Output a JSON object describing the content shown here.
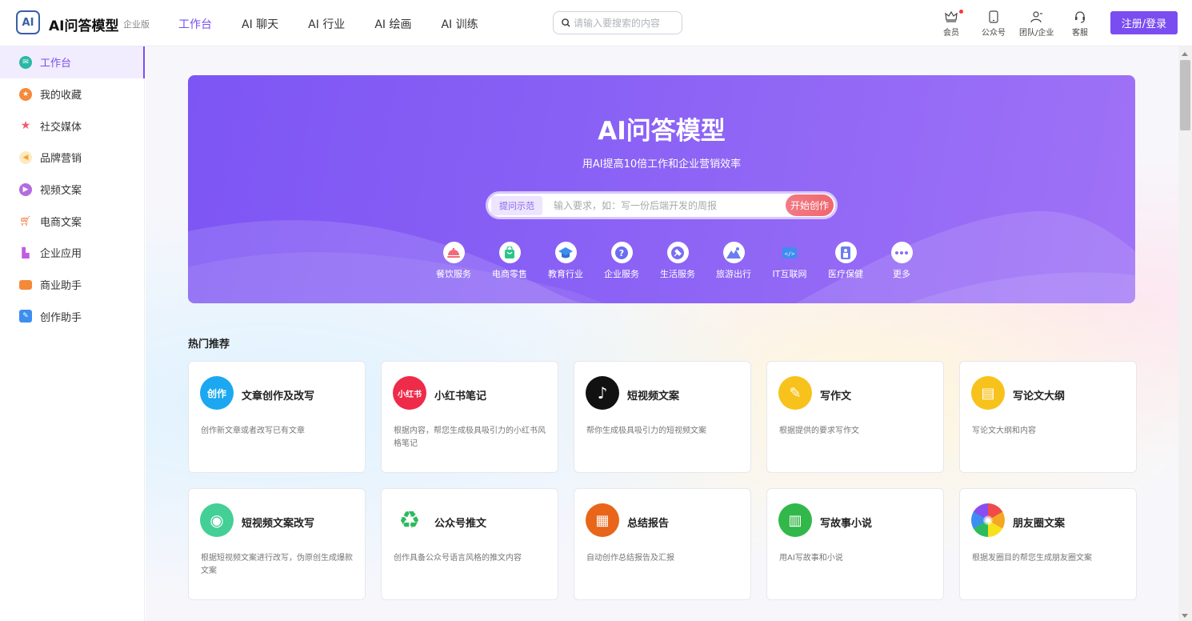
{
  "header": {
    "logo_text": "AI",
    "title": "AI问答模型",
    "edition": "企业版",
    "nav": [
      {
        "label": "工作台",
        "active": true
      },
      {
        "label": "AI 聊天"
      },
      {
        "label": "AI 行业"
      },
      {
        "label": "AI 绘画"
      },
      {
        "label": "AI 训练"
      }
    ],
    "search_placeholder": "请输入要搜索的内容",
    "tools": [
      {
        "label": "会员",
        "icon": "crown-icon"
      },
      {
        "label": "公众号",
        "icon": "phone-icon"
      },
      {
        "label": "团队/企业",
        "icon": "team-icon"
      },
      {
        "label": "客服",
        "icon": "headset-icon"
      }
    ],
    "login_label": "注册/登录"
  },
  "sidebar": {
    "items": [
      {
        "label": "工作台",
        "color": "#2bb9a6",
        "active": true
      },
      {
        "label": "我的收藏",
        "color": "#f58a3c"
      },
      {
        "label": "社交媒体",
        "color": "#ef5a6b"
      },
      {
        "label": "品牌营销",
        "color": "#f5a623"
      },
      {
        "label": "视频文案",
        "color": "#b46be0"
      },
      {
        "label": "电商文案",
        "color": "#f47a3a"
      },
      {
        "label": "企业应用",
        "color": "#c15be0"
      },
      {
        "label": "商业助手",
        "color": "#f5893a"
      },
      {
        "label": "创作助手",
        "color": "#3d8ef0"
      }
    ]
  },
  "banner": {
    "title": "AI问答模型",
    "subtitle": "用AI提高10倍工作和企业营销效率",
    "prompt_tag": "提问示范",
    "prompt_placeholder": "输入要求，如：写一份后端开发的周报",
    "prompt_button": "开始创作",
    "industries": [
      {
        "label": "餐饮服务",
        "icon": "dish-icon",
        "color": "#f06a7e"
      },
      {
        "label": "电商零售",
        "icon": "shopping-bag-icon",
        "color": "#2bc58a"
      },
      {
        "label": "教育行业",
        "icon": "graduation-cap-icon",
        "color": "#3d8ef0"
      },
      {
        "label": "企业服务",
        "icon": "question-icon",
        "color": "#6b6df0"
      },
      {
        "label": "生活服务",
        "icon": "hammer-icon",
        "color": "#7a6df0"
      },
      {
        "label": "旅游出行",
        "icon": "mountain-icon",
        "color": "#6a7ef0"
      },
      {
        "label": "IT互联网",
        "icon": "code-icon",
        "color": "#3d8ef0"
      },
      {
        "label": "医疗保健",
        "icon": "medical-icon",
        "color": "#6b7ef0"
      },
      {
        "label": "更多",
        "icon": "more-icon",
        "color": "#8a6df0"
      }
    ]
  },
  "hot": {
    "title": "热门推荐",
    "cards": [
      {
        "title": "文章创作及改写",
        "desc": "创作新文章或者改写已有文章",
        "icon": "write-icon",
        "icon_text": "创作",
        "color": "#1ba8f0"
      },
      {
        "title": "小红书笔记",
        "desc": "根据内容，帮您生成极具吸引力的小红书风格笔记",
        "icon": "xiaohongshu-icon",
        "icon_text": "小红书",
        "color": "#ef2b4a"
      },
      {
        "title": "短视频文案",
        "desc": "帮你生成极具吸引力的短视频文案",
        "icon": "tiktok-icon",
        "icon_text": "♪",
        "color": "#111111"
      },
      {
        "title": "写作文",
        "desc": "根据提供的要求写作文",
        "icon": "pencil-note-icon",
        "icon_text": "✎",
        "color": "#f7c21b"
      },
      {
        "title": "写论文大纲",
        "desc": "写论文大纲和内容",
        "icon": "document-icon",
        "icon_text": "▤",
        "color": "#f7c21b"
      },
      {
        "title": "短视频文案改写",
        "desc": "根据短视频文案进行改写，伪原创生成爆款文案",
        "icon": "camera-icon",
        "icon_text": "◉",
        "color": "#43cf96"
      },
      {
        "title": "公众号推文",
        "desc": "创作具备公众号语言风格的推文内容",
        "icon": "recycle-icon",
        "icon_text": "♻",
        "color": "#2cbb5d"
      },
      {
        "title": "总结报告",
        "desc": "自动创作总结报告及汇报",
        "icon": "chart-board-icon",
        "icon_text": "▦",
        "color": "#e8651a"
      },
      {
        "title": "写故事小说",
        "desc": "用AI写故事和小说",
        "icon": "book-icon",
        "icon_text": "▥",
        "color": "#32b84a"
      },
      {
        "title": "朋友圈文案",
        "desc": "根据发圈目的帮您生成朋友圈文案",
        "icon": "aperture-icon",
        "icon_text": "✺",
        "color": "#ffffff"
      }
    ]
  }
}
